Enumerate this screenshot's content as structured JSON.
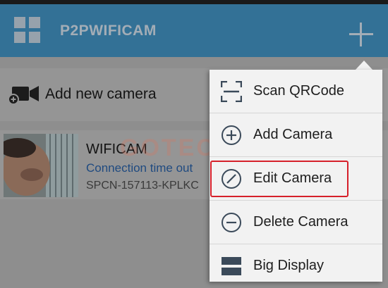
{
  "app_bar": {
    "title": "P2PWIFICAM",
    "menu_icon": "grid-icon",
    "add_icon": "plus-icon",
    "color": "#3f8ab8"
  },
  "add_row": {
    "label": "Add new camera",
    "icon": "add-camera-icon"
  },
  "camera": {
    "name": "WIFICAM",
    "status": "Connection time out",
    "uid": "SPCN-157113-KPLKC"
  },
  "watermark": "GOTECH",
  "menu": {
    "items": [
      {
        "label": "Scan QRCode",
        "icon": "scan-qrcode-icon"
      },
      {
        "label": "Add Camera",
        "icon": "add-circle-icon"
      },
      {
        "label": "Edit Camera",
        "icon": "edit-circle-icon"
      },
      {
        "label": "Delete Camera",
        "icon": "remove-circle-icon"
      },
      {
        "label": "Big Display",
        "icon": "big-display-icon"
      }
    ],
    "highlight_color": "#d6202a"
  }
}
